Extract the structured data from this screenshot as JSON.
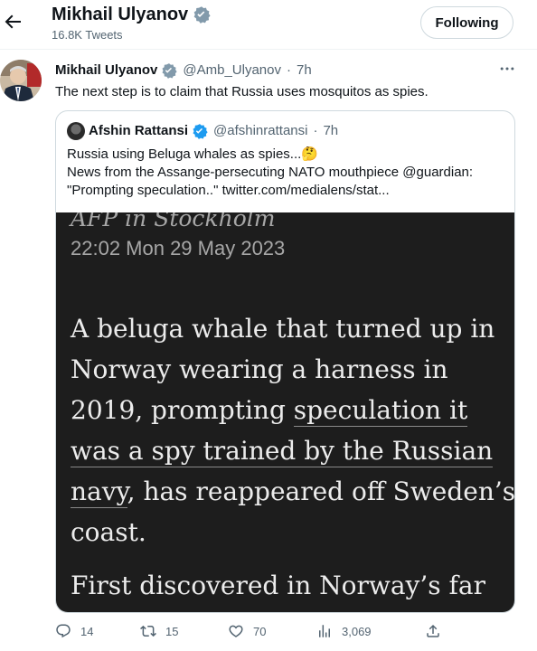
{
  "header": {
    "name": "Mikhail Ulyanov",
    "tweet_count": "16.8K Tweets",
    "follow_button": "Following"
  },
  "tweet": {
    "author_name": "Mikhail Ulyanov",
    "handle": "@Amb_Ulyanov",
    "separator": "·",
    "time": "7h",
    "text": "The next step is to claim that Russia uses mosquitos as spies."
  },
  "quote": {
    "author_name": "Afshin Rattansi",
    "handle": "@afshinrattansi",
    "separator": "·",
    "time": "7h",
    "lines": [
      "Russia using Beluga whales as spies...🤔",
      "News from the Assange-persecuting NATO mouthpiece @guardian:",
      "\"Prompting speculation..\"  twitter.com/medialens/stat..."
    ]
  },
  "article_image": {
    "byline": "AFP in Stockholm",
    "date": "22:02 Mon 29 May 2023",
    "paragraph_1": {
      "line_1": "A beluga whale that turned up in",
      "line_2": "Norway wearing a harness in",
      "line_3_a": "2019, prompting ",
      "line_3_b": "speculation it",
      "line_4": "was a spy trained by the Russian",
      "line_5_a": "navy",
      "line_5_b": ", has reappeared off Sweden’s",
      "line_6": "coast."
    },
    "paragraph_2": "First discovered in Norway’s far"
  },
  "actions": {
    "reply_count": "14",
    "retweet_count": "15",
    "like_count": "70",
    "view_count": "3,069"
  },
  "icons": {
    "back": "arrow-left-icon",
    "verified": "verified-badge-icon",
    "more": "more-icon",
    "reply": "reply-icon",
    "retweet": "retweet-icon",
    "like": "heart-icon",
    "views": "views-icon",
    "share": "share-icon"
  },
  "colors": {
    "verified": "#1d9bf0",
    "secondary_text": "#536471",
    "image_bg": "#1d1d1d"
  }
}
